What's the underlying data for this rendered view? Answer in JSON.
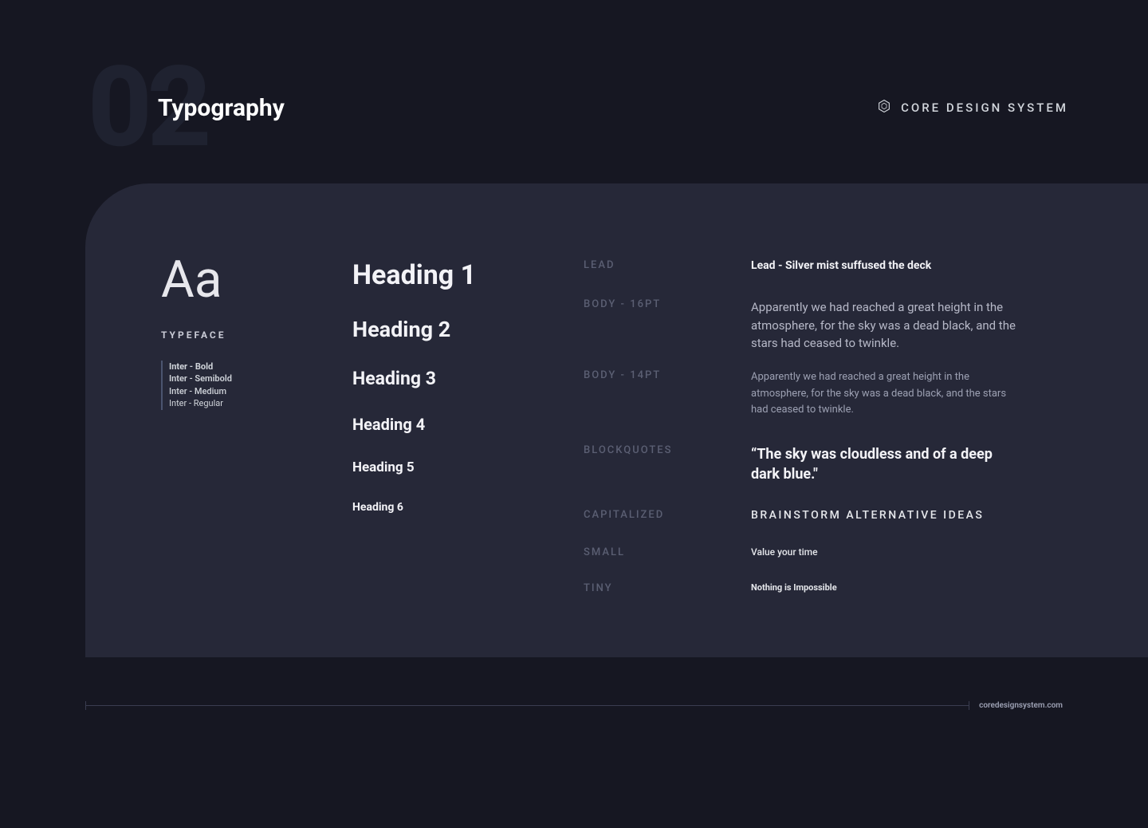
{
  "header": {
    "page_number": "02",
    "title": "Typography",
    "brand": "CORE DESIGN SYSTEM"
  },
  "typeface": {
    "specimen": "Aa",
    "label": "TYPEFACE",
    "weights": {
      "bold": "Inter - Bold",
      "semibold": "Inter - Semibold",
      "medium": "Inter - Medium",
      "regular": "Inter - Regular"
    }
  },
  "headings": {
    "h1": "Heading 1",
    "h2": "Heading 2",
    "h3": "Heading 3",
    "h4": "Heading 4",
    "h5": "Heading 5",
    "h6": "Heading 6"
  },
  "labels": {
    "lead": "LEAD",
    "body16": "BODY - 16PT",
    "body14": "BODY - 14PT",
    "blockquotes": "BLOCKQUOTES",
    "capitalized": "CAPITALIZED",
    "small": "SMALL",
    "tiny": "TINY"
  },
  "examples": {
    "lead": "Lead - Silver mist suffused the deck",
    "body16": "Apparently we had reached a great height in the atmosphere, for the sky was a dead black, and the stars had ceased to twinkle.",
    "body14": "Apparently we had reached a great height in the atmosphere, for the sky was a dead black, and the stars had ceased to twinkle.",
    "blockquote": "“The sky was cloudless and of a deep dark blue.\"",
    "capitalized": "BRAINSTORM ALTERNATIVE IDEAS",
    "small": "Value your time",
    "tiny": "Nothing is Impossible"
  },
  "footer": {
    "domain": "coredesignsystem.com"
  }
}
